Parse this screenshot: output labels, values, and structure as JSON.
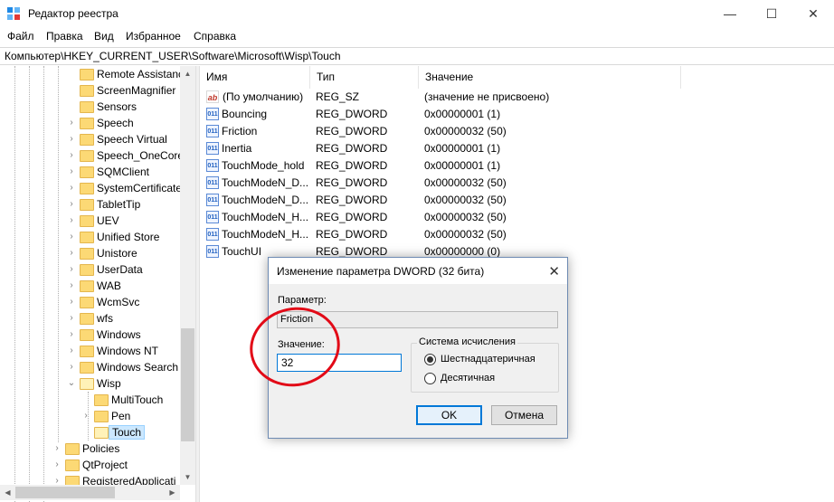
{
  "window": {
    "title": "Редактор реестра",
    "minimize": "—",
    "maximize": "☐",
    "close": "✕"
  },
  "menu": [
    "Файл",
    "Правка",
    "Вид",
    "Избранное",
    "Справка"
  ],
  "address": "Компьютер\\HKEY_CURRENT_USER\\Software\\Microsoft\\Wisp\\Touch",
  "tree": {
    "items": [
      {
        "label": "Remote Assistanc",
        "chev": ""
      },
      {
        "label": "ScreenMagnifier",
        "chev": ""
      },
      {
        "label": "Sensors",
        "chev": ""
      },
      {
        "label": "Speech",
        "chev": "›"
      },
      {
        "label": "Speech Virtual",
        "chev": "›"
      },
      {
        "label": "Speech_OneCore",
        "chev": "›"
      },
      {
        "label": "SQMClient",
        "chev": "›"
      },
      {
        "label": "SystemCertificate",
        "chev": "›"
      },
      {
        "label": "TabletTip",
        "chev": "›"
      },
      {
        "label": "UEV",
        "chev": "›"
      },
      {
        "label": "Unified Store",
        "chev": "›"
      },
      {
        "label": "Unistore",
        "chev": "›"
      },
      {
        "label": "UserData",
        "chev": "›"
      },
      {
        "label": "WAB",
        "chev": "›"
      },
      {
        "label": "WcmSvc",
        "chev": "›"
      },
      {
        "label": "wfs",
        "chev": "›"
      },
      {
        "label": "Windows",
        "chev": "›"
      },
      {
        "label": "Windows NT",
        "chev": "›"
      },
      {
        "label": "Windows Search",
        "chev": "›"
      },
      {
        "label": "Wisp",
        "chev": "⌄"
      },
      {
        "label": "MultiTouch",
        "chev": ""
      },
      {
        "label": "Pen",
        "chev": "›"
      },
      {
        "label": "Touch",
        "chev": ""
      },
      {
        "label": "Policies",
        "chev": "›"
      },
      {
        "label": "QtProject",
        "chev": "›"
      },
      {
        "label": "RegisteredApplicati",
        "chev": "›"
      }
    ]
  },
  "list": {
    "columns": [
      "Имя",
      "Тип",
      "Значение"
    ],
    "rows": [
      {
        "name": "(По умолчанию)",
        "type": "REG_SZ",
        "value": "(значение не присвоено)",
        "icon": "string-value-icon",
        "glyph": "ab"
      },
      {
        "name": "Bouncing",
        "type": "REG_DWORD",
        "value": "0x00000001 (1)",
        "icon": "dword-value-icon",
        "glyph": "011"
      },
      {
        "name": "Friction",
        "type": "REG_DWORD",
        "value": "0x00000032 (50)",
        "icon": "dword-value-icon",
        "glyph": "011"
      },
      {
        "name": "Inertia",
        "type": "REG_DWORD",
        "value": "0x00000001 (1)",
        "icon": "dword-value-icon",
        "glyph": "011"
      },
      {
        "name": "TouchMode_hold",
        "type": "REG_DWORD",
        "value": "0x00000001 (1)",
        "icon": "dword-value-icon",
        "glyph": "011"
      },
      {
        "name": "TouchModeN_D...",
        "type": "REG_DWORD",
        "value": "0x00000032 (50)",
        "icon": "dword-value-icon",
        "glyph": "011"
      },
      {
        "name": "TouchModeN_D...",
        "type": "REG_DWORD",
        "value": "0x00000032 (50)",
        "icon": "dword-value-icon",
        "glyph": "011"
      },
      {
        "name": "TouchModeN_H...",
        "type": "REG_DWORD",
        "value": "0x00000032 (50)",
        "icon": "dword-value-icon",
        "glyph": "011"
      },
      {
        "name": "TouchModeN_H...",
        "type": "REG_DWORD",
        "value": "0x00000032 (50)",
        "icon": "dword-value-icon",
        "glyph": "011"
      },
      {
        "name": "TouchUI",
        "type": "REG_DWORD",
        "value": "0x00000000 (0)",
        "icon": "dword-value-icon",
        "glyph": "011"
      }
    ]
  },
  "dialog": {
    "title": "Изменение параметра DWORD (32 бита)",
    "close": "✕",
    "param_label": "Параметр:",
    "param_value": "Friction",
    "value_label": "Значение:",
    "value": "32",
    "base_label": "Система исчисления",
    "base_hex": "Шестнадцатеричная",
    "base_dec": "Десятичная",
    "ok": "OK",
    "cancel": "Отмена"
  },
  "colors": {
    "annotation": "#e20a17",
    "selection": "#cce8ff",
    "accent": "#0078d7"
  }
}
